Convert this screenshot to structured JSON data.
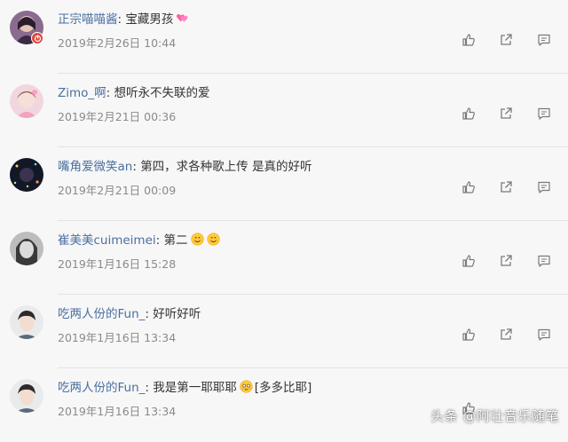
{
  "comments": [
    {
      "user": "正宗喵喵酱",
      "sep": ": ",
      "text": "宝藏男孩",
      "emoji": "heart",
      "time": "2019年2月26日 10:44",
      "avatar": "girl-red",
      "badge": true
    },
    {
      "user": "Zimo_啊",
      "sep": ": ",
      "text": "想听永不失联的爱",
      "emoji": "",
      "time": "2019年2月21日 00:36",
      "avatar": "girl-pink",
      "badge": false
    },
    {
      "user": "嘴角爱微笑an",
      "sep": ": ",
      "text": "第四，求各种歌上传 是真的好听",
      "emoji": "",
      "time": "2019年2月21日 00:09",
      "avatar": "dark-lights",
      "badge": false
    },
    {
      "user": "崔美美cuimeimei",
      "sep": ": ",
      "text": "第二",
      "emoji": "smile2",
      "time": "2019年1月16日 15:28",
      "avatar": "girl-bw",
      "badge": false
    },
    {
      "user": "吃两人份的Fun_",
      "sep": ": ",
      "text": "好听好听",
      "emoji": "",
      "time": "2019年1月16日 13:34",
      "avatar": "boy",
      "badge": false
    },
    {
      "user": "吃两人份的Fun_",
      "sep": ": ",
      "text": "我是第一耶耶耶",
      "emoji": "blush",
      "text2": "[多多比耶]",
      "time": "2019年1月16日 13:34",
      "avatar": "boy",
      "badge": false
    }
  ],
  "watermark": "头条 @阿壮音乐随笔",
  "icons": {
    "like": "thumbs-up-icon",
    "share": "share-icon",
    "reply": "comment-icon"
  },
  "colors": {
    "username": "#4a6fa0",
    "time": "#8a8a8a",
    "badge": "#e0463c"
  }
}
